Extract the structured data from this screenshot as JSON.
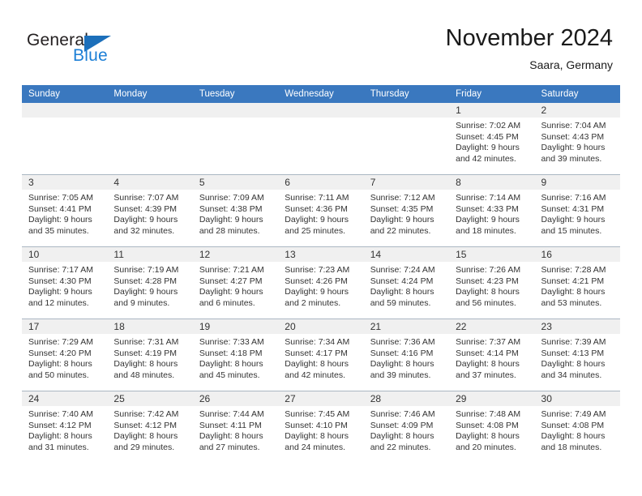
{
  "brand": {
    "name_part1": "General",
    "name_part2": "Blue",
    "triangle_icon": "triangle-logo-icon",
    "color_dark": "#231f20",
    "color_blue": "#1c7fd6"
  },
  "header": {
    "month_title": "November 2024",
    "location": "Saara, Germany"
  },
  "calendar": {
    "accent_color": "#3a78bf",
    "daynum_background": "#f0f0f0",
    "weekday_headers": [
      "Sunday",
      "Monday",
      "Tuesday",
      "Wednesday",
      "Thursday",
      "Friday",
      "Saturday"
    ],
    "weeks": [
      [
        {
          "day": "",
          "lines": []
        },
        {
          "day": "",
          "lines": []
        },
        {
          "day": "",
          "lines": []
        },
        {
          "day": "",
          "lines": []
        },
        {
          "day": "",
          "lines": []
        },
        {
          "day": "1",
          "lines": [
            "Sunrise: 7:02 AM",
            "Sunset: 4:45 PM",
            "Daylight: 9 hours",
            "and 42 minutes."
          ]
        },
        {
          "day": "2",
          "lines": [
            "Sunrise: 7:04 AM",
            "Sunset: 4:43 PM",
            "Daylight: 9 hours",
            "and 39 minutes."
          ]
        }
      ],
      [
        {
          "day": "3",
          "lines": [
            "Sunrise: 7:05 AM",
            "Sunset: 4:41 PM",
            "Daylight: 9 hours",
            "and 35 minutes."
          ]
        },
        {
          "day": "4",
          "lines": [
            "Sunrise: 7:07 AM",
            "Sunset: 4:39 PM",
            "Daylight: 9 hours",
            "and 32 minutes."
          ]
        },
        {
          "day": "5",
          "lines": [
            "Sunrise: 7:09 AM",
            "Sunset: 4:38 PM",
            "Daylight: 9 hours",
            "and 28 minutes."
          ]
        },
        {
          "day": "6",
          "lines": [
            "Sunrise: 7:11 AM",
            "Sunset: 4:36 PM",
            "Daylight: 9 hours",
            "and 25 minutes."
          ]
        },
        {
          "day": "7",
          "lines": [
            "Sunrise: 7:12 AM",
            "Sunset: 4:35 PM",
            "Daylight: 9 hours",
            "and 22 minutes."
          ]
        },
        {
          "day": "8",
          "lines": [
            "Sunrise: 7:14 AM",
            "Sunset: 4:33 PM",
            "Daylight: 9 hours",
            "and 18 minutes."
          ]
        },
        {
          "day": "9",
          "lines": [
            "Sunrise: 7:16 AM",
            "Sunset: 4:31 PM",
            "Daylight: 9 hours",
            "and 15 minutes."
          ]
        }
      ],
      [
        {
          "day": "10",
          "lines": [
            "Sunrise: 7:17 AM",
            "Sunset: 4:30 PM",
            "Daylight: 9 hours",
            "and 12 minutes."
          ]
        },
        {
          "day": "11",
          "lines": [
            "Sunrise: 7:19 AM",
            "Sunset: 4:28 PM",
            "Daylight: 9 hours",
            "and 9 minutes."
          ]
        },
        {
          "day": "12",
          "lines": [
            "Sunrise: 7:21 AM",
            "Sunset: 4:27 PM",
            "Daylight: 9 hours",
            "and 6 minutes."
          ]
        },
        {
          "day": "13",
          "lines": [
            "Sunrise: 7:23 AM",
            "Sunset: 4:26 PM",
            "Daylight: 9 hours",
            "and 2 minutes."
          ]
        },
        {
          "day": "14",
          "lines": [
            "Sunrise: 7:24 AM",
            "Sunset: 4:24 PM",
            "Daylight: 8 hours",
            "and 59 minutes."
          ]
        },
        {
          "day": "15",
          "lines": [
            "Sunrise: 7:26 AM",
            "Sunset: 4:23 PM",
            "Daylight: 8 hours",
            "and 56 minutes."
          ]
        },
        {
          "day": "16",
          "lines": [
            "Sunrise: 7:28 AM",
            "Sunset: 4:21 PM",
            "Daylight: 8 hours",
            "and 53 minutes."
          ]
        }
      ],
      [
        {
          "day": "17",
          "lines": [
            "Sunrise: 7:29 AM",
            "Sunset: 4:20 PM",
            "Daylight: 8 hours",
            "and 50 minutes."
          ]
        },
        {
          "day": "18",
          "lines": [
            "Sunrise: 7:31 AM",
            "Sunset: 4:19 PM",
            "Daylight: 8 hours",
            "and 48 minutes."
          ]
        },
        {
          "day": "19",
          "lines": [
            "Sunrise: 7:33 AM",
            "Sunset: 4:18 PM",
            "Daylight: 8 hours",
            "and 45 minutes."
          ]
        },
        {
          "day": "20",
          "lines": [
            "Sunrise: 7:34 AM",
            "Sunset: 4:17 PM",
            "Daylight: 8 hours",
            "and 42 minutes."
          ]
        },
        {
          "day": "21",
          "lines": [
            "Sunrise: 7:36 AM",
            "Sunset: 4:16 PM",
            "Daylight: 8 hours",
            "and 39 minutes."
          ]
        },
        {
          "day": "22",
          "lines": [
            "Sunrise: 7:37 AM",
            "Sunset: 4:14 PM",
            "Daylight: 8 hours",
            "and 37 minutes."
          ]
        },
        {
          "day": "23",
          "lines": [
            "Sunrise: 7:39 AM",
            "Sunset: 4:13 PM",
            "Daylight: 8 hours",
            "and 34 minutes."
          ]
        }
      ],
      [
        {
          "day": "24",
          "lines": [
            "Sunrise: 7:40 AM",
            "Sunset: 4:12 PM",
            "Daylight: 8 hours",
            "and 31 minutes."
          ]
        },
        {
          "day": "25",
          "lines": [
            "Sunrise: 7:42 AM",
            "Sunset: 4:12 PM",
            "Daylight: 8 hours",
            "and 29 minutes."
          ]
        },
        {
          "day": "26",
          "lines": [
            "Sunrise: 7:44 AM",
            "Sunset: 4:11 PM",
            "Daylight: 8 hours",
            "and 27 minutes."
          ]
        },
        {
          "day": "27",
          "lines": [
            "Sunrise: 7:45 AM",
            "Sunset: 4:10 PM",
            "Daylight: 8 hours",
            "and 24 minutes."
          ]
        },
        {
          "day": "28",
          "lines": [
            "Sunrise: 7:46 AM",
            "Sunset: 4:09 PM",
            "Daylight: 8 hours",
            "and 22 minutes."
          ]
        },
        {
          "day": "29",
          "lines": [
            "Sunrise: 7:48 AM",
            "Sunset: 4:08 PM",
            "Daylight: 8 hours",
            "and 20 minutes."
          ]
        },
        {
          "day": "30",
          "lines": [
            "Sunrise: 7:49 AM",
            "Sunset: 4:08 PM",
            "Daylight: 8 hours",
            "and 18 minutes."
          ]
        }
      ]
    ]
  }
}
